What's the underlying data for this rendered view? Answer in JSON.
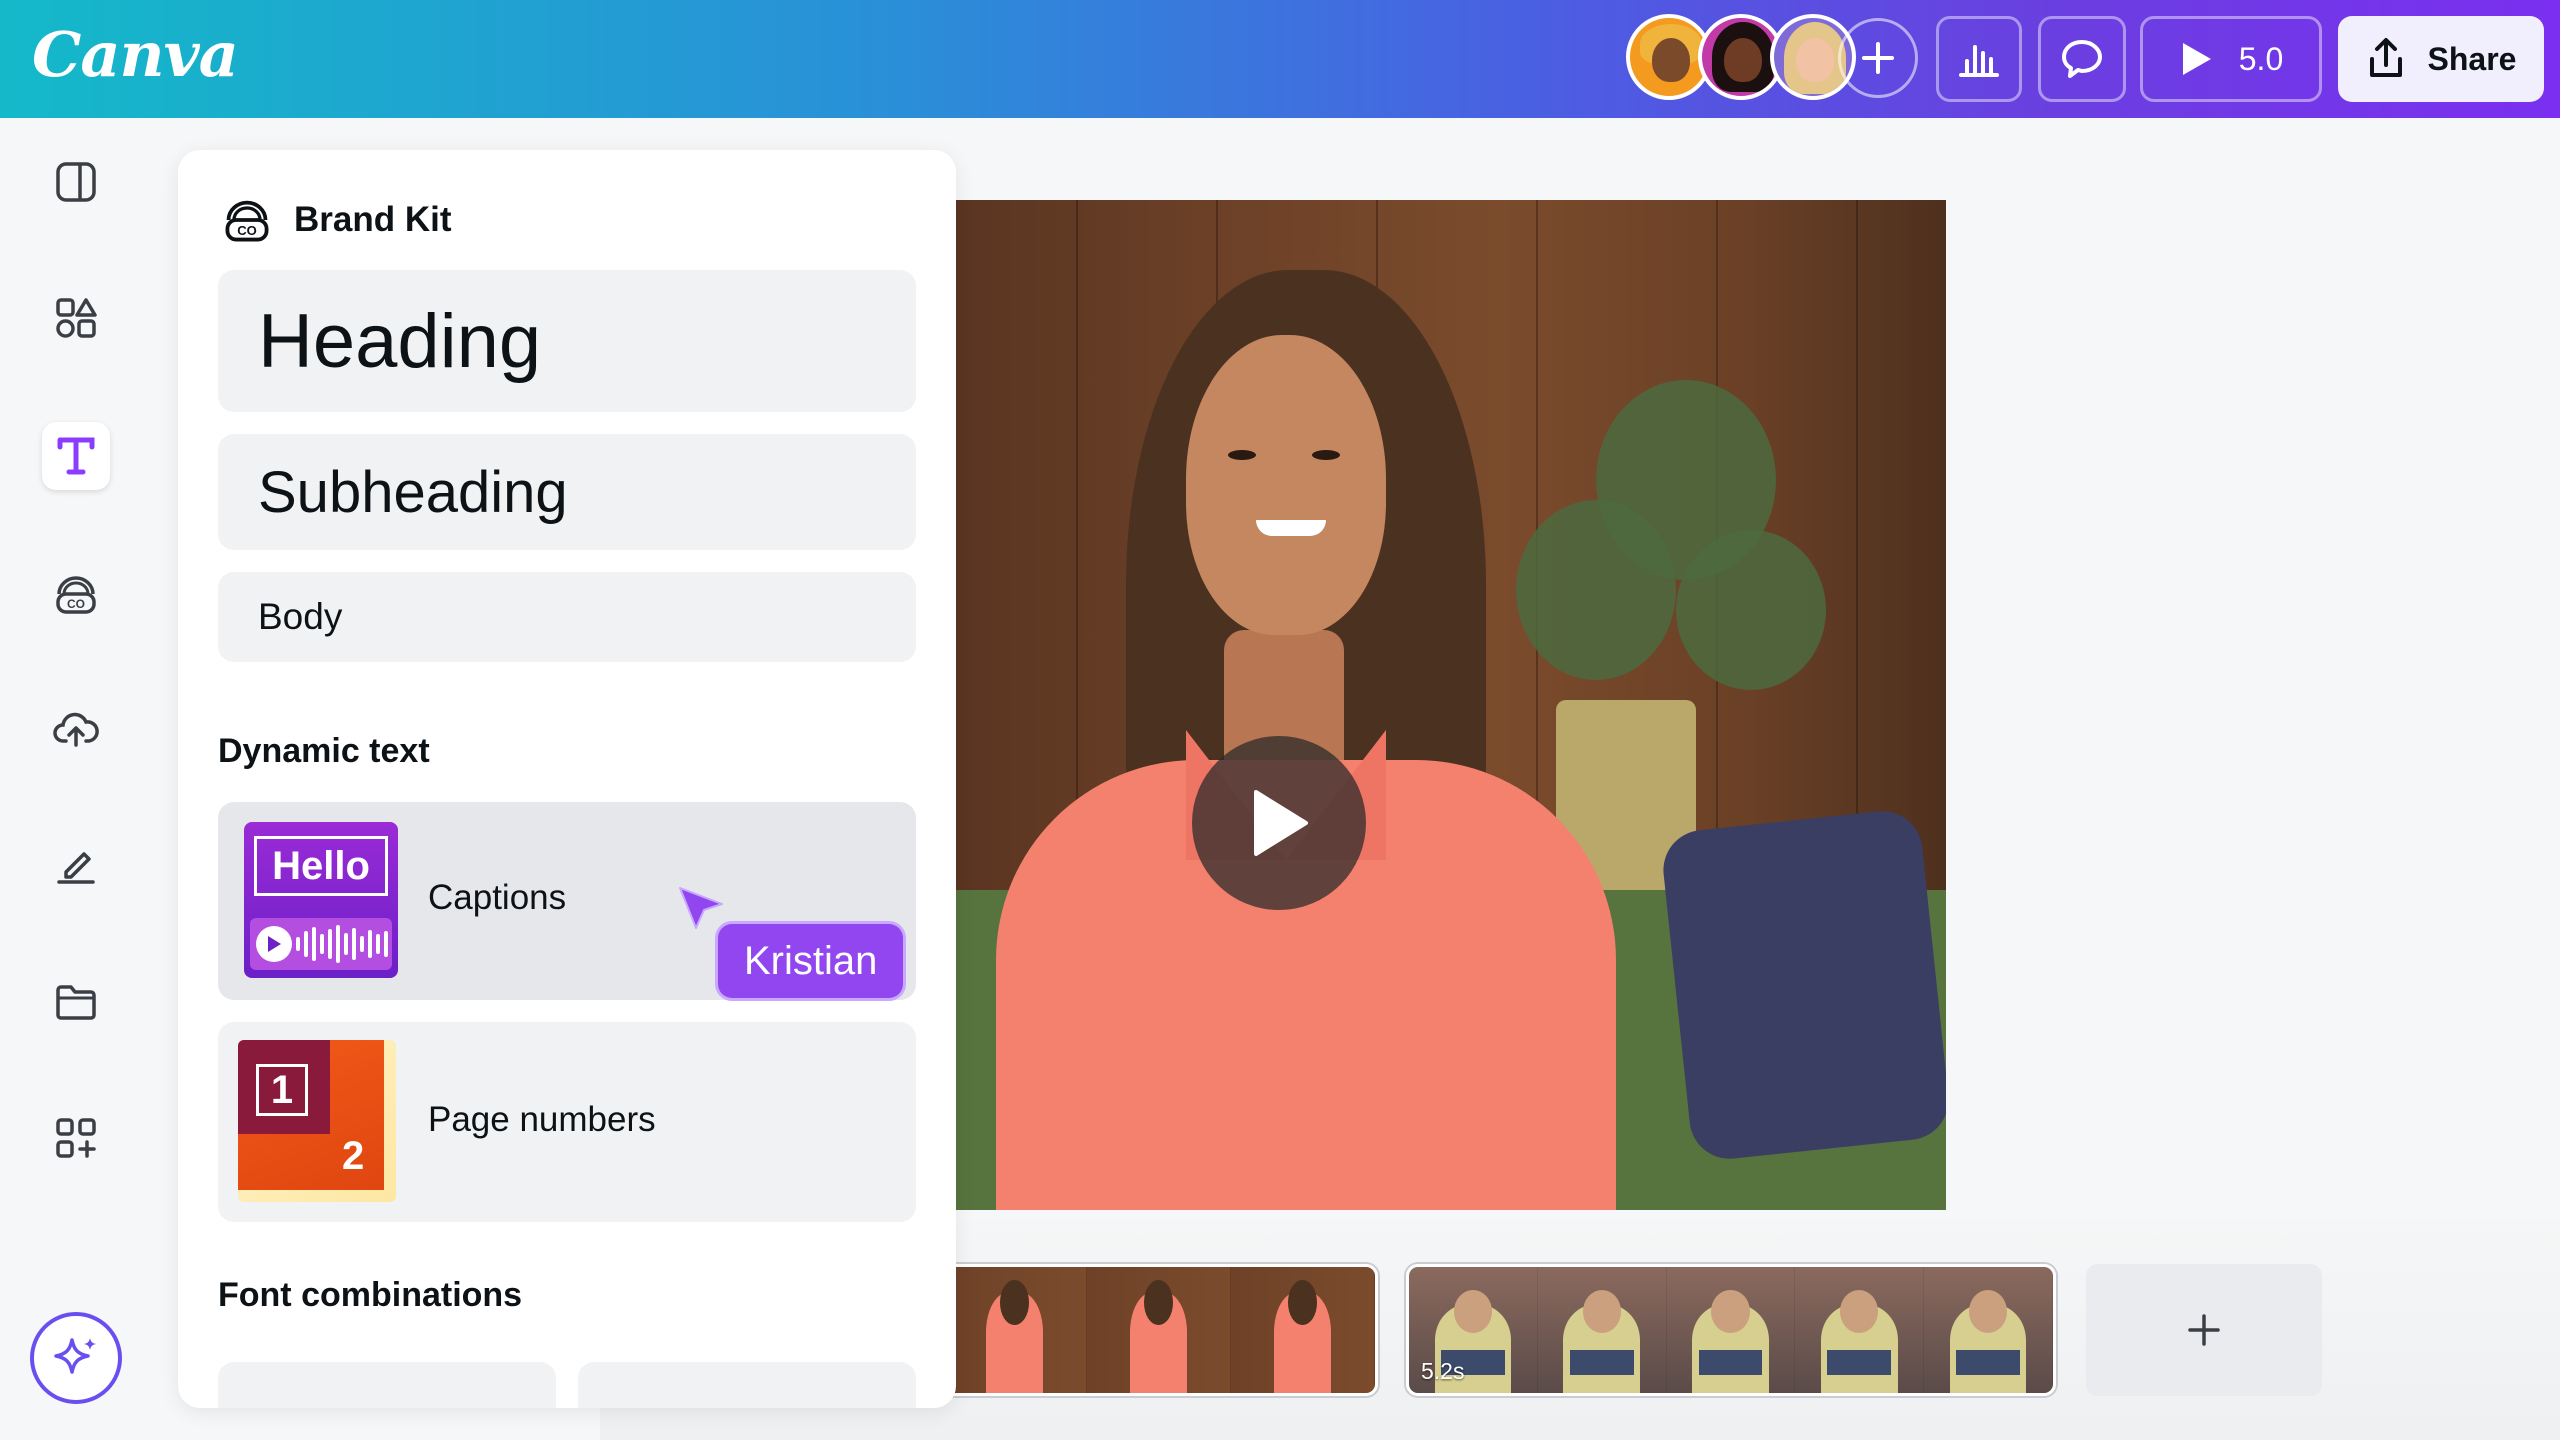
{
  "app": {
    "logo": "Canva",
    "brand_gradient": [
      "#14b9c9",
      "#7b2ff0"
    ],
    "accent": "#9146f0"
  },
  "topbar": {
    "collaborators": [
      "avatar",
      "avatar",
      "avatar"
    ],
    "present_label": "5.0",
    "share_label": "Share"
  },
  "rail": {
    "items": [
      {
        "icon": "layout-icon"
      },
      {
        "icon": "elements-icon"
      },
      {
        "icon": "text-icon",
        "active": true
      },
      {
        "icon": "brand-icon"
      },
      {
        "icon": "upload-icon"
      },
      {
        "icon": "draw-icon"
      },
      {
        "icon": "folder-icon"
      },
      {
        "icon": "apps-icon"
      }
    ],
    "magic": {
      "icon": "sparkle-icon"
    }
  },
  "panel": {
    "title": "Brand Kit",
    "styles": {
      "heading": "Heading",
      "subheading": "Subheading",
      "body": "Body"
    },
    "dynamic_text": {
      "title": "Dynamic text",
      "items": [
        {
          "label": "Captions",
          "thumb_text": "Hello"
        },
        {
          "label": "Page numbers",
          "thumb_numbers": [
            "1",
            "2"
          ]
        }
      ]
    },
    "font_combinations": {
      "title": "Font combinations"
    }
  },
  "collaborator_cursor": {
    "name": "Kristian",
    "color": "#9146f0"
  },
  "timeline": {
    "clips": [
      {
        "duration": ""
      },
      {
        "duration": "5.2s"
      }
    ]
  }
}
